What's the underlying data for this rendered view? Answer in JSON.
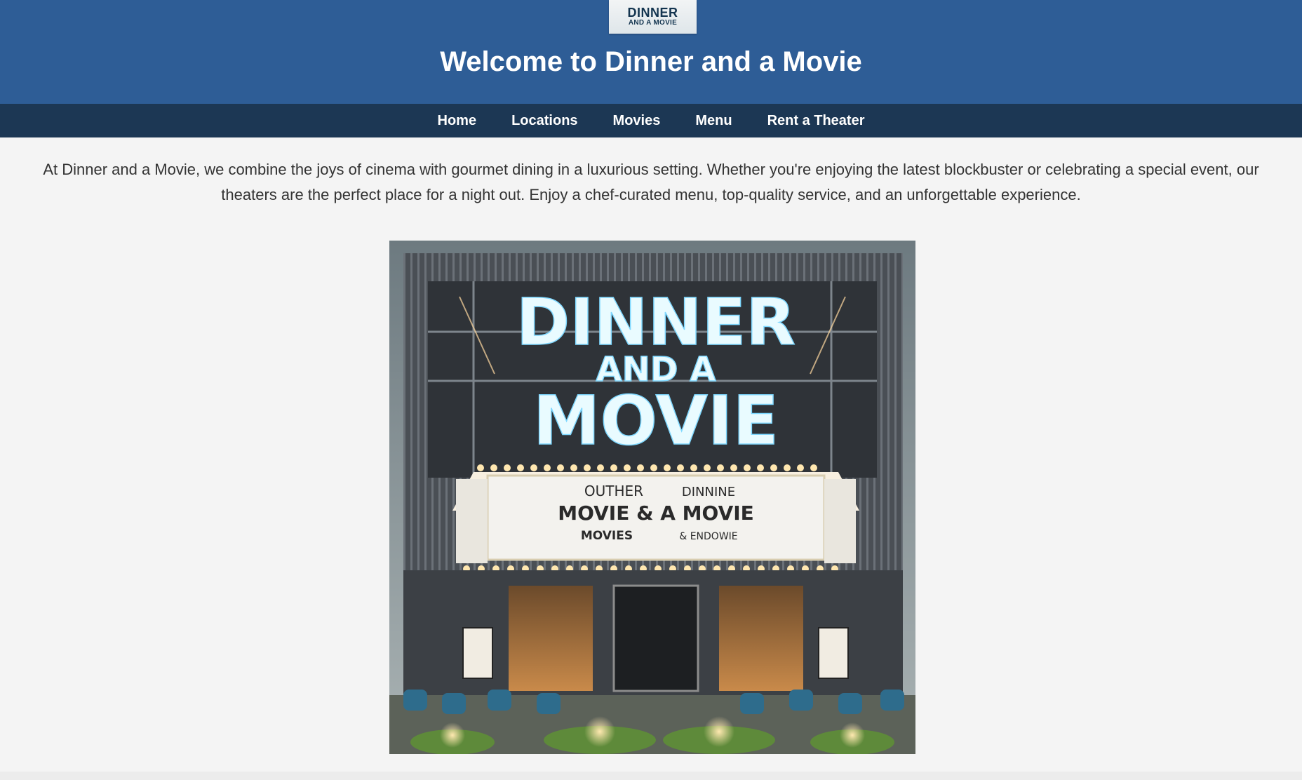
{
  "logo": {
    "line1": "DINNER",
    "line2": "AND A MOVIE"
  },
  "header": {
    "title": "Welcome to Dinner and a Movie"
  },
  "nav": {
    "items": [
      {
        "label": "Home"
      },
      {
        "label": "Locations"
      },
      {
        "label": "Movies"
      },
      {
        "label": "Menu"
      },
      {
        "label": "Rent a Theater"
      }
    ]
  },
  "intro": {
    "text": "At Dinner and a Movie, we combine the joys of cinema with gourmet dining in a luxurious setting. Whether you're enjoying the latest blockbuster or celebrating a special event, our theaters are the perfect place for a night out. Enjoy a chef-curated menu, top-quality service, and an unforgettable experience."
  },
  "hero": {
    "sign": {
      "line1": "DINNER",
      "line2": "AND A",
      "line3": "MOVIE"
    },
    "marquee": {
      "row1a": "OUTHER",
      "row1b": "DINNINE",
      "row2": "MOVIE & A MOVIE",
      "row3a": "MOVIES",
      "row3b": "& ENDOWIE"
    }
  },
  "colors": {
    "header": "#2e5d96",
    "nav": "#1c3754",
    "background": "#f4f4f4"
  }
}
